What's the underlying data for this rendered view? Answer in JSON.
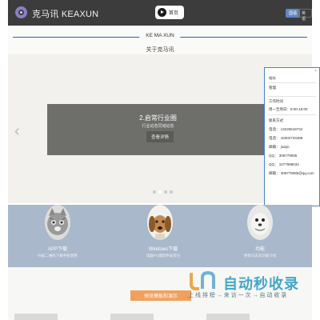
{
  "header": {
    "brand": "克马讯 KEAXUN",
    "home_label": "首页",
    "lang_left": "国语",
    "lang_right": "英语"
  },
  "section_header": {
    "tag": "KE MA XUN",
    "subtitle": "关于克马讯"
  },
  "banner": {
    "prev_arrow": "‹",
    "slide_title": "2.启常行业圈",
    "slide_subtitle": "行业动态同城动态",
    "slide_button": "查看详情",
    "total_slides": 4,
    "active_slide": 2
  },
  "contact_panel": {
    "close_label": "×",
    "rows": [
      "站长",
      "管理",
      "工作时间",
      "周一至周日：8:00-18:00",
      "联系方式",
      "电话：  13225518734",
      "电话：  18302733489",
      "邮箱：  jixiqic",
      "QQ：  309779085",
      "QQ：  1077998034",
      "邮箱：  309779085@qq.com"
    ]
  },
  "features": [
    {
      "icon": "cat-icon",
      "label": "APP下载",
      "desc": "扫描二维码下载手机使用"
    },
    {
      "icon": "dog-icon",
      "label": "Windows下载",
      "desc": "电脑PC端软件安装包"
    },
    {
      "icon": "seal-icon",
      "label": "功能",
      "desc": "更新日志及功能介绍"
    }
  ],
  "lower": {
    "demo_button": "预览模板和演示"
  },
  "watermark": {
    "name": "自动秒收录",
    "slogan": "上 线 排 榜 → 来 访 一 次 → 自 动 收 录"
  },
  "colors": {
    "topbar": "#3c3c3c",
    "accent_blue": "#2e5fa8",
    "feature_bg": "#a9b8cb",
    "demo_orange": "#f2a05c",
    "slide_bg": "#6e6e6b"
  }
}
